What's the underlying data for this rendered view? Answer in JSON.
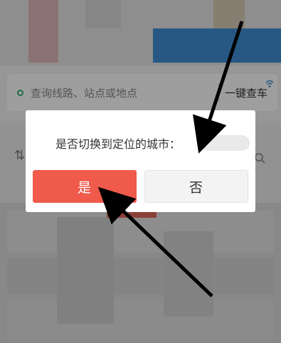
{
  "search": {
    "placeholder": "查询线路、站点或地点",
    "one_key_label": "一键查车"
  },
  "dialog": {
    "message": "是否切换到定位的城市：",
    "yes_label": "是",
    "no_label": "否"
  },
  "colors": {
    "accent_red": "#ef5a4b",
    "banner_blue": "#3f8fd6",
    "search_green": "#3bb273"
  },
  "icons": [
    "wifi-icon",
    "swap-icon",
    "search-icon",
    "arrow-annotation"
  ]
}
